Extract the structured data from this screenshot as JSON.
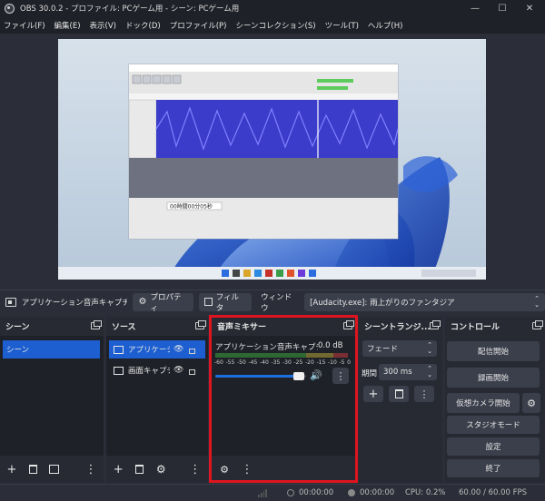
{
  "window": {
    "title": "OBS 30.0.2 - プロファイル: PCゲーム用 - シーン: PCゲーム用",
    "minimize": "—",
    "maximize": "☐",
    "close": "✕"
  },
  "menu": [
    "ファイル(F)",
    "編集(E)",
    "表示(V)",
    "ドック(D)",
    "プロファイル(P)",
    "シーンコレクション(S)",
    "ツール(T)",
    "ヘルプ(H)"
  ],
  "source_toolbar": {
    "source_name": "アプリケーション音声キャプチャ (",
    "properties_label": "プロパティ",
    "filters_label": "フィルタ",
    "window_label": "ウィンドウ",
    "window_value": "[Audacity.exe]: 雨上がりのファンタジア"
  },
  "scenes": {
    "header": "シーン",
    "items": [
      "シーン"
    ]
  },
  "sources": {
    "header": "ソース",
    "items": [
      {
        "label": "アプリケーショ",
        "icon": "audio-app-icon"
      },
      {
        "label": "画面キャプチ",
        "icon": "monitor-icon"
      }
    ]
  },
  "mixer": {
    "header": "音声ミキサー",
    "channel_name": "アプリケーション音声キャプチャ (ペー",
    "db_value": "0.0 dB",
    "scale": [
      "-60",
      "-55",
      "-50",
      "-45",
      "-40",
      "-35",
      "-30",
      "-25",
      "-20",
      "-15",
      "-10",
      "-5",
      "0"
    ],
    "volume_level": 0.9
  },
  "transitions": {
    "header": "シーントランジ...",
    "type": "フェード",
    "duration_label": "期間",
    "duration_value": "300 ms"
  },
  "controls": {
    "header": "コントロール",
    "start_streaming": "配信開始",
    "start_recording": "録画開始",
    "start_virtual_camera": "仮想カメラ開始",
    "studio_mode": "スタジオモード",
    "settings": "設定",
    "exit": "終了"
  },
  "status": {
    "stream_time": "00:00:00",
    "record_time": "00:00:00",
    "cpu": "CPU: 0.2%",
    "fps": "60.00 / 60.00 FPS"
  },
  "preview": {
    "audacity_time": "00時間00分05秒"
  },
  "colors": {
    "accent_blue": "#1d5fd0",
    "highlight_red": "#e0141e",
    "waveform": "#3b3cc9",
    "meter_green": "#3fbf3f",
    "meter_yellow": "#d8c23a",
    "meter_red": "#d23b3b"
  }
}
